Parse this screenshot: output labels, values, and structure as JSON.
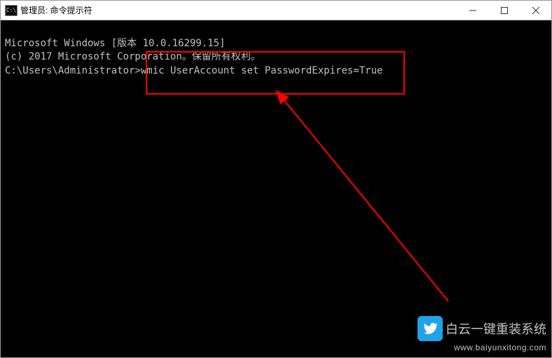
{
  "titlebar": {
    "icon_text": "C:\\",
    "title": "管理员: 命令提示符"
  },
  "terminal": {
    "line1": "Microsoft Windows [版本 10.0.16299.15]",
    "line2": "(c) 2017 Microsoft Corporation。保留所有权利。",
    "line3": "",
    "prompt": "C:\\Users\\Administrator>",
    "command": "wmic UserAccount set PasswordExpires=True"
  },
  "watermark": {
    "text": "白云一键重装系统",
    "url": "www.baiyunxitong.com"
  }
}
